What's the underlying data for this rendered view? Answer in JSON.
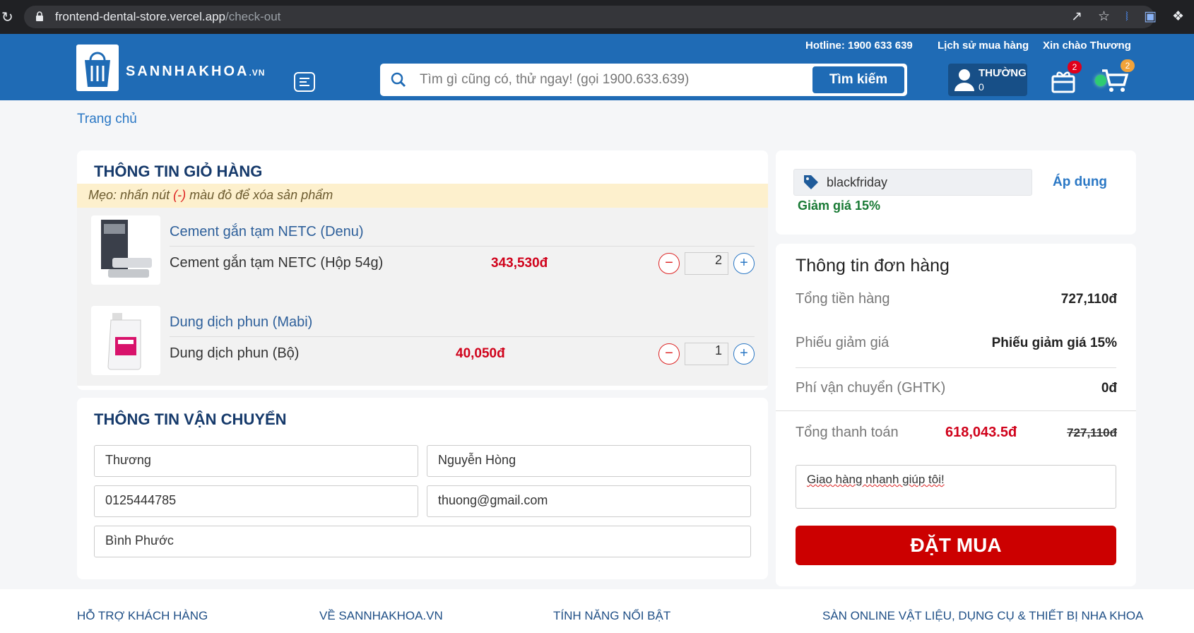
{
  "browser": {
    "url_host": "frontend-dental-store.vercel.app",
    "url_path": "/check-out"
  },
  "header": {
    "logo_text": "SANNHAKHOA",
    "logo_suffix": ".VN",
    "hotline": "Hotline: 1900 633 639",
    "order_history": "Lịch sử mua hàng",
    "greeting": "Xin chào Thương",
    "search_placeholder": "Tìm gì cũng có, thử ngay! (gọi 1900.633.639)",
    "search_button": "Tìm kiếm",
    "user_rank": "THƯỜNG",
    "user_points": "0",
    "gift_badge": "2",
    "cart_badge": "2"
  },
  "breadcrumb": "Trang chủ",
  "cart": {
    "title": "THÔNG TIN GIỎ HÀNG",
    "tip_prefix": "Mẹo: nhấn nút ",
    "tip_minus": "(-)",
    "tip_suffix": " màu đỏ để xóa sản phẩm",
    "items": [
      {
        "name": "Cement gắn tạm NETC (Denu)",
        "variant": "Cement gắn tạm NETC (Hộp 54g)",
        "price": "343,530đ",
        "qty": "2"
      },
      {
        "name": "Dung dịch phun (Mabi)",
        "variant": "Dung dịch phun (Bộ)",
        "price": "40,050đ",
        "qty": "1"
      }
    ]
  },
  "shipping": {
    "title": "THÔNG TIN VẬN CHUYỂN",
    "first_name": "Thương",
    "last_name": "Nguyễn Hòng",
    "phone": "0125444785",
    "email": "thuong@gmail.com",
    "address": "Bình Phước"
  },
  "coupon": {
    "code": "blackfriday",
    "apply": "Áp dụng",
    "note": "Giảm giá 15%"
  },
  "order": {
    "title": "Thông tin đơn hàng",
    "subtotal_label": "Tổng tiền hàng",
    "subtotal_value": "727,110đ",
    "voucher_label": "Phiếu giảm giá",
    "voucher_value": "Phiếu giảm giá 15%",
    "shipping_label": "Phí vận chuyển (GHTK)",
    "shipping_value": "0đ",
    "total_label": "Tổng thanh toán",
    "total_value": "618,043.5đ",
    "total_original": "727,110đ",
    "note": "Giao hàng nhanh giúp tôi!",
    "submit": "ĐẶT MUA"
  },
  "footer": {
    "col1": "HỖ TRỢ KHÁCH HÀNG",
    "col2": "VỀ SANNHAKHOA.VN",
    "col3": "TÍNH NĂNG NỔI BẬT",
    "col4": "SÀN ONLINE VẬT LIỆU, DỤNG CỤ & THIẾT BỊ NHA KHOA"
  },
  "colors": {
    "brand_blue": "#1f6bb5",
    "price_red": "#d0021b",
    "order_button": "#cc0000",
    "discount_green": "#197a35"
  }
}
